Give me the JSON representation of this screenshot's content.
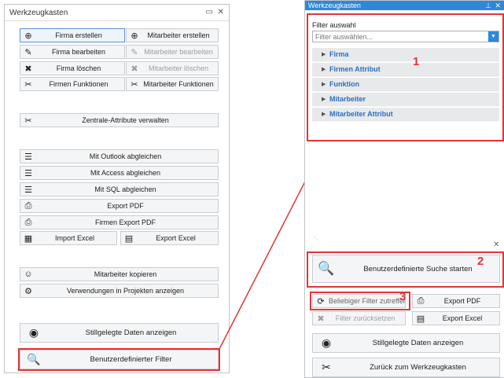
{
  "left_panel": {
    "title": "Werkzeugkasten",
    "window_icon": "restore-icon",
    "close_icon": "close-icon",
    "rows": [
      {
        "left": {
          "label": "Firma erstellen",
          "icon": "plus-circle-icon",
          "glyph": "⊕",
          "dim": false,
          "selected": true
        },
        "right": {
          "label": "Mitarbeiter erstellen",
          "icon": "plus-circle-icon",
          "glyph": "⊕",
          "dim": false
        }
      },
      {
        "left": {
          "label": "Firma bearbeiten",
          "icon": "edit-icon",
          "glyph": "✎",
          "dim": false
        },
        "right": {
          "label": "Mitarbeiter bearbeiten",
          "icon": "edit-icon",
          "glyph": "✎",
          "dim": true
        }
      },
      {
        "left": {
          "label": "Firma löschen",
          "icon": "delete-x-icon",
          "glyph": "✖",
          "dim": false
        },
        "right": {
          "label": "Mitarbeiter löschen",
          "icon": "delete-x-icon",
          "glyph": "✖",
          "dim": true
        }
      },
      {
        "left": {
          "label": "Firmen Funktionen",
          "icon": "tools-icon",
          "glyph": "✂",
          "dim": false
        },
        "right": {
          "label": "Mitarbeiter Funktionen",
          "icon": "tools-icon",
          "glyph": "✂",
          "dim": false
        }
      }
    ],
    "zentrale": {
      "label": "Zentrale-Attribute verwalten",
      "icon": "tools-icon",
      "glyph": "✂"
    },
    "sync_buttons": [
      {
        "label": "Mit Outlook abgleichen",
        "icon": "list-sync-icon",
        "glyph": "☰"
      },
      {
        "label": "Mit Access abgleichen",
        "icon": "list-sync-icon",
        "glyph": "☰"
      },
      {
        "label": "Mit SQL abgleichen",
        "icon": "list-sync-icon",
        "glyph": "☰"
      },
      {
        "label": "Export PDF",
        "icon": "pdf-export-icon",
        "glyph": "⎙"
      },
      {
        "label": "Firmen Export PDF",
        "icon": "pdf-export-icon",
        "glyph": "⎙"
      }
    ],
    "excel_row": {
      "import": {
        "label": "Import Excel",
        "icon": "excel-import-icon",
        "glyph": "▦"
      },
      "export": {
        "label": "Export Excel",
        "icon": "excel-export-icon",
        "glyph": "▤"
      }
    },
    "misc_buttons": [
      {
        "label": "Mitarbeiter kopieren",
        "icon": "users-copy-icon",
        "glyph": "☺"
      },
      {
        "label": "Verwendungen in Projekten anzeigen",
        "icon": "projects-icon",
        "glyph": "⚙"
      }
    ],
    "stillgelegte": {
      "label": "Stillgelegte Daten anzeigen",
      "icon": "eye-icon",
      "glyph": "◉"
    },
    "custom_filter": {
      "label": "Benutzerdefinierter Filter",
      "icon": "search-icon",
      "glyph": "🔍"
    }
  },
  "right_panel": {
    "title": "Werkzeugkasten",
    "pin_icon": "pin-icon",
    "close_icon": "close-icon",
    "filter_label": "Filter auswahl",
    "filter_placeholder": "Filter auswählen...",
    "tree_items": [
      "Firma",
      "Firmen Attribut",
      "Funktion",
      "Mitarbeiter",
      "Mitarbeiter Attribut"
    ],
    "search_button": {
      "label": "Benutzerdefinierte Suche starten",
      "icon": "search-icon",
      "glyph": "🔍"
    },
    "any_filter": {
      "label": "Beliebiger Filter zutreffen",
      "icon": "refresh-icon",
      "glyph": "⟳"
    },
    "export_pdf": {
      "label": "Export PDF",
      "icon": "pdf-export-icon",
      "glyph": "⎙"
    },
    "reset_filter": {
      "label": "Filter zurücksetzen",
      "icon": "reset-x-icon",
      "glyph": "✖"
    },
    "export_excel": {
      "label": "Export Excel",
      "icon": "excel-export-icon",
      "glyph": "▤"
    },
    "stillgelegte": {
      "label": "Stillgelegte Daten anzeigen",
      "icon": "eye-icon",
      "glyph": "◉"
    },
    "back": {
      "label": "Zurück zum Werkzeugkasten",
      "icon": "tools-icon",
      "glyph": "✂"
    }
  },
  "annotations": {
    "n1": "1",
    "n2": "2",
    "n3": "3"
  },
  "colors": {
    "accent": "#2f87d8",
    "highlight": "#e23535",
    "tree_text": "#2b6fc0"
  }
}
